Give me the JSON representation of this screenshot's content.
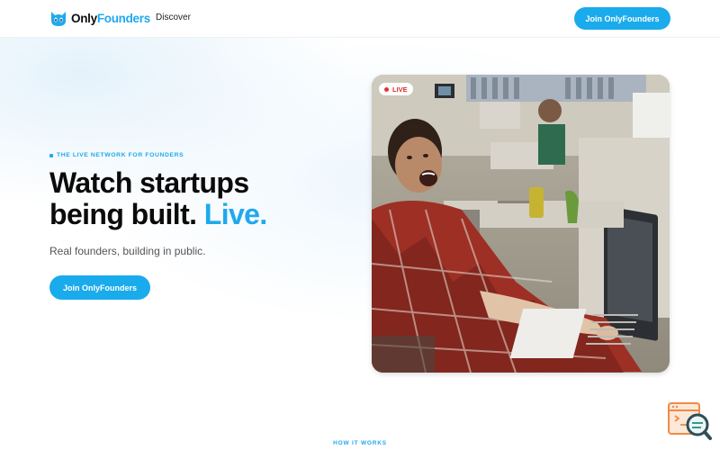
{
  "brand": {
    "name_part1": "Only",
    "name_part2": "Founders",
    "accent": "#1fa9ee"
  },
  "nav": {
    "discover_label": "Discover",
    "cta_label": "Join OnlyFounders"
  },
  "hero": {
    "eyebrow": "THE LIVE NETWORK FOR FOUNDERS",
    "headline_line1": "Watch startups",
    "headline_line2": "being built.",
    "headline_accent": "Live.",
    "subtext": "Real founders, building in public.",
    "cta_label": "Join OnlyFounders"
  },
  "video": {
    "badge_label": "LIVE",
    "badge_color": "#e8312f"
  },
  "section": {
    "how_it_works": "HOW IT WORKS"
  }
}
